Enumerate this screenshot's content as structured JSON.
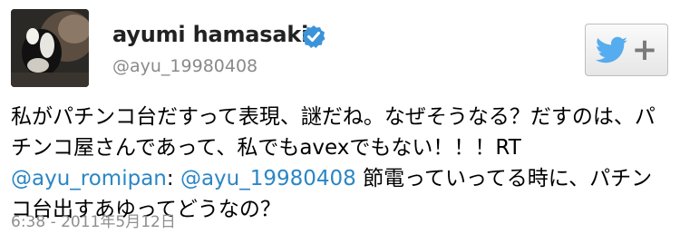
{
  "user": {
    "name": "ayumi hamasaki",
    "handle": "@ayu_19980408"
  },
  "follow_button": {
    "icon": "twitter-bird-icon",
    "plus": "+"
  },
  "tweet": {
    "text_1": "私がパチンコ台だすって表現、謎だね。なぜそうなる？だすのは、パチンコ屋さんであって、私でもavexでもない！！！RT",
    "mention_1": "@ayu_romipan",
    "colon": ": ",
    "mention_2": "@ayu_19980408",
    "text_2": " 節電っていってる時に、パチンコ台出すあゆってどうなの？"
  },
  "meta": {
    "timestamp": "6:38 - 2011年5月12日"
  },
  "colors": {
    "link": "#2b86c5",
    "verified": "#3b94d9",
    "bird": "#55acee"
  }
}
